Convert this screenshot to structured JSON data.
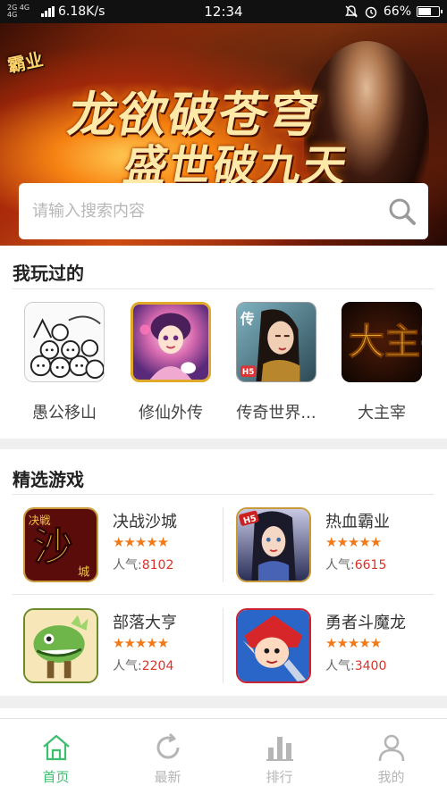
{
  "status_bar": {
    "network": "2G 4G 4G",
    "speed": "6.18K/s",
    "time": "12:34",
    "battery": "66%",
    "battery_level": 0.66
  },
  "banner": {
    "logo_text": "霸业",
    "slogan_line1": "龙欲破苍穹",
    "slogan_line2": "盛世破九天"
  },
  "search": {
    "placeholder": "请输入搜索内容"
  },
  "played_section": {
    "title": "我玩过的",
    "items": [
      {
        "name": "愚公移山",
        "icon": "crowd-icon"
      },
      {
        "name": "修仙外传",
        "icon": "fairy-girl-icon"
      },
      {
        "name": "传奇世界...",
        "icon": "warrior-woman-icon"
      },
      {
        "name": "大主宰",
        "icon": "calligraphy-icon"
      }
    ]
  },
  "featured_section": {
    "title": "精选游戏",
    "popularity_label": "人气:",
    "items": [
      {
        "name": "决战沙城",
        "rating": 5,
        "popularity": "8102",
        "icon": "sand-city-icon"
      },
      {
        "name": "热血霸业",
        "rating": 5,
        "popularity": "6615",
        "icon": "heroine-icon"
      },
      {
        "name": "部落大亨",
        "rating": 5,
        "popularity": "2204",
        "icon": "dino-icon"
      },
      {
        "name": "勇者斗魔龙",
        "rating": 5,
        "popularity": "3400",
        "icon": "elf-hero-icon"
      }
    ]
  },
  "tabbar": {
    "items": [
      {
        "label": "首页",
        "icon": "home-icon",
        "active": true
      },
      {
        "label": "最新",
        "icon": "refresh-icon",
        "active": false
      },
      {
        "label": "排行",
        "icon": "bar-chart-icon",
        "active": false
      },
      {
        "label": "我的",
        "icon": "user-icon",
        "active": false
      }
    ]
  },
  "colors": {
    "accent": "#3cbf6e",
    "star": "#f07a1a",
    "popularity_value": "#d9332a"
  }
}
